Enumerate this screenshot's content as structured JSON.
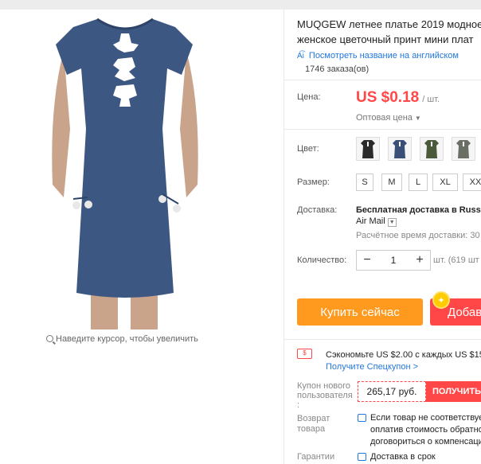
{
  "product": {
    "title": "MUQGEW летнее платье 2019 модное женское цветочный принт мини плат",
    "translate_link": "Посмотреть название на английском",
    "orders": "1746 заказа(ов)",
    "zoom_hint": "Наведите курсор, чтобы увеличить"
  },
  "price": {
    "label": "Цена:",
    "value": "US $0.18",
    "unit": "/ шт.",
    "wholesale": "Оптовая цена"
  },
  "color": {
    "label": "Цвет:",
    "swatches": [
      {
        "name": "black",
        "hex": "#2b2b2b"
      },
      {
        "name": "navy",
        "hex": "#3a4f78"
      },
      {
        "name": "army-green",
        "hex": "#4b5a3a"
      },
      {
        "name": "gray",
        "hex": "#6a6f66"
      }
    ]
  },
  "size": {
    "label": "Размер:",
    "options": [
      "S",
      "M",
      "L",
      "XL",
      "XX"
    ]
  },
  "shipping": {
    "label": "Доставка:",
    "main": "Бесплатная доставка в Russia",
    "method": "Air Mail",
    "time": "Расчётное время доставки: 30"
  },
  "quantity": {
    "label": "Количество:",
    "minus": "−",
    "value": "1",
    "plus": "+",
    "note": "шт. (619 шт"
  },
  "actions": {
    "buy_now": "Купить сейчас",
    "add_to_cart": "Добав",
    "coin_icon": "star-coin-icon"
  },
  "coupon": {
    "save_text": "Сэкономьте US $2.00 с каждых US $15.0",
    "link": "Получите Спецкупон >",
    "newuser_label": "Купон нового пользователя :",
    "newuser_amount": "265,17 руб.",
    "get": "ПОЛУЧИТЬ"
  },
  "returns": {
    "label": "Возврат товара",
    "text": "Если товар не соответствуе оплатив стоимость обратно договориться о компенсаци"
  },
  "warranty": {
    "label": "Гарантии",
    "text": "Доставка в срок"
  },
  "colors": {
    "accent_red": "#ff4747",
    "buy_orange": "#ff9a1e",
    "link_blue": "#2277dd"
  }
}
